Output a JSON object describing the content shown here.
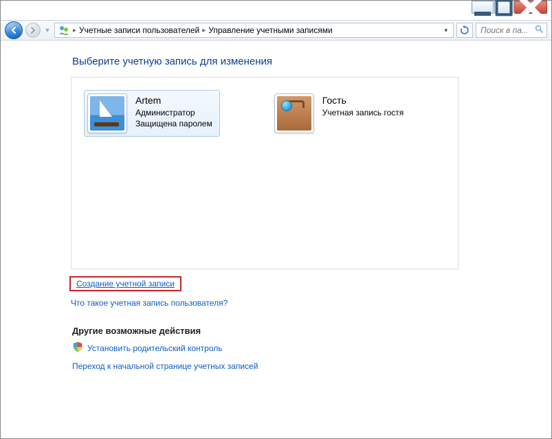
{
  "breadcrumb": {
    "item1": "Учетные записи пользователей",
    "item2": "Управление учетными записями"
  },
  "search": {
    "placeholder": "Поиск в па..."
  },
  "heading": "Выберите учетную запись для изменения",
  "accounts": {
    "artem": {
      "name": "Artem",
      "role": "Администратор",
      "status": "Защищена паролем"
    },
    "guest": {
      "name": "Гость",
      "desc": "Учетная запись гостя"
    }
  },
  "links": {
    "create_account": "Создание учетной записи",
    "what_is_account": "Что такое учетная запись пользователя?",
    "other_heading": "Другие возможные действия",
    "parental": "Установить родительский контроль",
    "goto_main": "Переход к начальной странице учетных записей"
  }
}
